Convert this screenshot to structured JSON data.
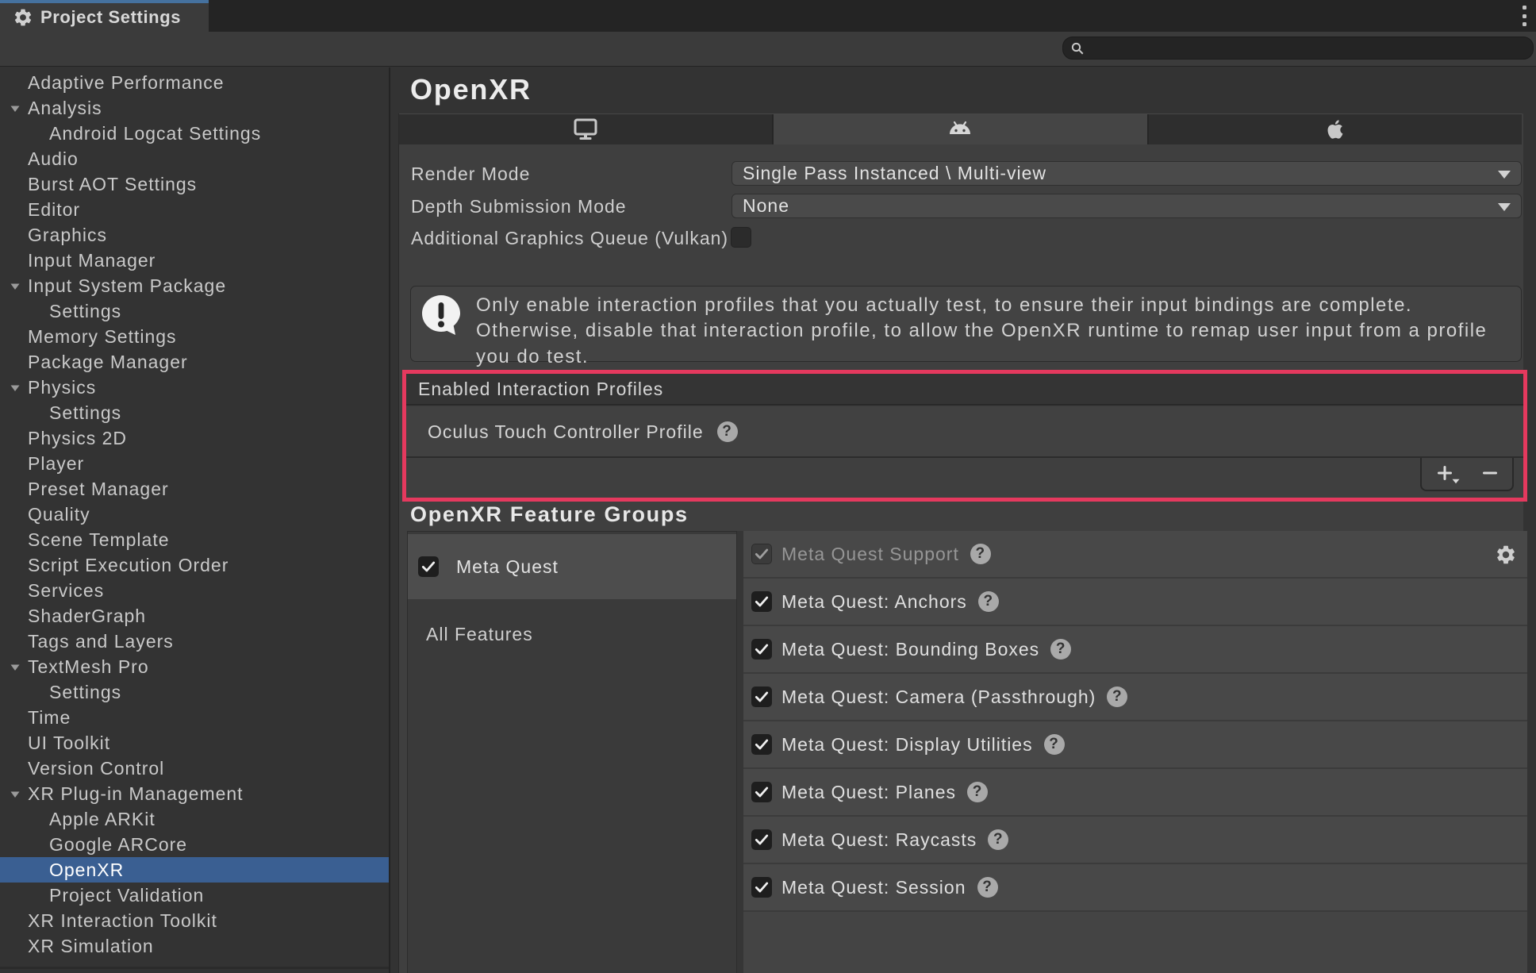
{
  "window": {
    "tab_title": "Project Settings"
  },
  "search": {
    "value": "",
    "placeholder": ""
  },
  "sidebar": {
    "items": [
      {
        "label": "Adaptive Performance",
        "level": 0,
        "expander": false,
        "selected": false
      },
      {
        "label": "Analysis",
        "level": 0,
        "expander": true,
        "selected": false
      },
      {
        "label": "Android Logcat Settings",
        "level": 1,
        "expander": false,
        "selected": false
      },
      {
        "label": "Audio",
        "level": 0,
        "expander": false,
        "selected": false
      },
      {
        "label": "Burst AOT Settings",
        "level": 0,
        "expander": false,
        "selected": false
      },
      {
        "label": "Editor",
        "level": 0,
        "expander": false,
        "selected": false
      },
      {
        "label": "Graphics",
        "level": 0,
        "expander": false,
        "selected": false
      },
      {
        "label": "Input Manager",
        "level": 0,
        "expander": false,
        "selected": false
      },
      {
        "label": "Input System Package",
        "level": 0,
        "expander": true,
        "selected": false
      },
      {
        "label": "Settings",
        "level": 1,
        "expander": false,
        "selected": false
      },
      {
        "label": "Memory Settings",
        "level": 0,
        "expander": false,
        "selected": false
      },
      {
        "label": "Package Manager",
        "level": 0,
        "expander": false,
        "selected": false
      },
      {
        "label": "Physics",
        "level": 0,
        "expander": true,
        "selected": false
      },
      {
        "label": "Settings",
        "level": 1,
        "expander": false,
        "selected": false
      },
      {
        "label": "Physics 2D",
        "level": 0,
        "expander": false,
        "selected": false
      },
      {
        "label": "Player",
        "level": 0,
        "expander": false,
        "selected": false
      },
      {
        "label": "Preset Manager",
        "level": 0,
        "expander": false,
        "selected": false
      },
      {
        "label": "Quality",
        "level": 0,
        "expander": false,
        "selected": false
      },
      {
        "label": "Scene Template",
        "level": 0,
        "expander": false,
        "selected": false
      },
      {
        "label": "Script Execution Order",
        "level": 0,
        "expander": false,
        "selected": false
      },
      {
        "label": "Services",
        "level": 0,
        "expander": false,
        "selected": false
      },
      {
        "label": "ShaderGraph",
        "level": 0,
        "expander": false,
        "selected": false
      },
      {
        "label": "Tags and Layers",
        "level": 0,
        "expander": false,
        "selected": false
      },
      {
        "label": "TextMesh Pro",
        "level": 0,
        "expander": true,
        "selected": false
      },
      {
        "label": "Settings",
        "level": 1,
        "expander": false,
        "selected": false
      },
      {
        "label": "Time",
        "level": 0,
        "expander": false,
        "selected": false
      },
      {
        "label": "UI Toolkit",
        "level": 0,
        "expander": false,
        "selected": false
      },
      {
        "label": "Version Control",
        "level": 0,
        "expander": false,
        "selected": false
      },
      {
        "label": "XR Plug-in Management",
        "level": 0,
        "expander": true,
        "selected": false
      },
      {
        "label": "Apple ARKit",
        "level": 1,
        "expander": false,
        "selected": false
      },
      {
        "label": "Google ARCore",
        "level": 1,
        "expander": false,
        "selected": false
      },
      {
        "label": "OpenXR",
        "level": 1,
        "expander": false,
        "selected": true
      },
      {
        "label": "Project Validation",
        "level": 1,
        "expander": false,
        "selected": false
      },
      {
        "label": "XR Interaction Toolkit",
        "level": 0,
        "expander": false,
        "selected": false
      },
      {
        "label": "XR Simulation",
        "level": 0,
        "expander": false,
        "selected": false
      }
    ]
  },
  "main": {
    "title": "OpenXR",
    "platform_tabs": [
      {
        "icon": "desktop-icon",
        "selected": false
      },
      {
        "icon": "android-icon",
        "selected": true
      },
      {
        "icon": "apple-icon",
        "selected": false
      }
    ],
    "fields": {
      "render_mode": {
        "label": "Render Mode",
        "value": "Single Pass Instanced \\ Multi-view"
      },
      "depth_submission_mode": {
        "label": "Depth Submission Mode",
        "value": "None"
      },
      "additional_graphics_queue": {
        "label": "Additional Graphics Queue (Vulkan)",
        "checked": false
      }
    },
    "warning": {
      "line1": "Only enable interaction profiles that you actually test, to ensure their input bindings are complete.",
      "line2": "Otherwise, disable that interaction profile, to allow the OpenXR runtime to remap user input from a profile",
      "line3": "you do test."
    },
    "interaction_profiles": {
      "header": "Enabled Interaction Profiles",
      "rows": [
        {
          "label": "Oculus Touch Controller Profile",
          "help": true
        }
      ],
      "add_label": "+",
      "remove_label": "−"
    },
    "feature_groups": {
      "heading": "OpenXR Feature Groups",
      "group_label": "Meta Quest",
      "group_checked": true,
      "all_features_label": "All Features",
      "features": [
        {
          "label": "Meta Quest Support",
          "checked": true,
          "disabled": true,
          "gear": true
        },
        {
          "label": "Meta Quest: Anchors",
          "checked": true,
          "disabled": false,
          "gear": false
        },
        {
          "label": "Meta Quest: Bounding Boxes",
          "checked": true,
          "disabled": false,
          "gear": false
        },
        {
          "label": "Meta Quest: Camera (Passthrough)",
          "checked": true,
          "disabled": false,
          "gear": false
        },
        {
          "label": "Meta Quest: Display Utilities",
          "checked": true,
          "disabled": false,
          "gear": false
        },
        {
          "label": "Meta Quest: Planes",
          "checked": true,
          "disabled": false,
          "gear": false
        },
        {
          "label": "Meta Quest: Raycasts",
          "checked": true,
          "disabled": false,
          "gear": false
        },
        {
          "label": "Meta Quest: Session",
          "checked": true,
          "disabled": false,
          "gear": false
        }
      ]
    },
    "annotation": {
      "color": "#e5395e"
    }
  }
}
